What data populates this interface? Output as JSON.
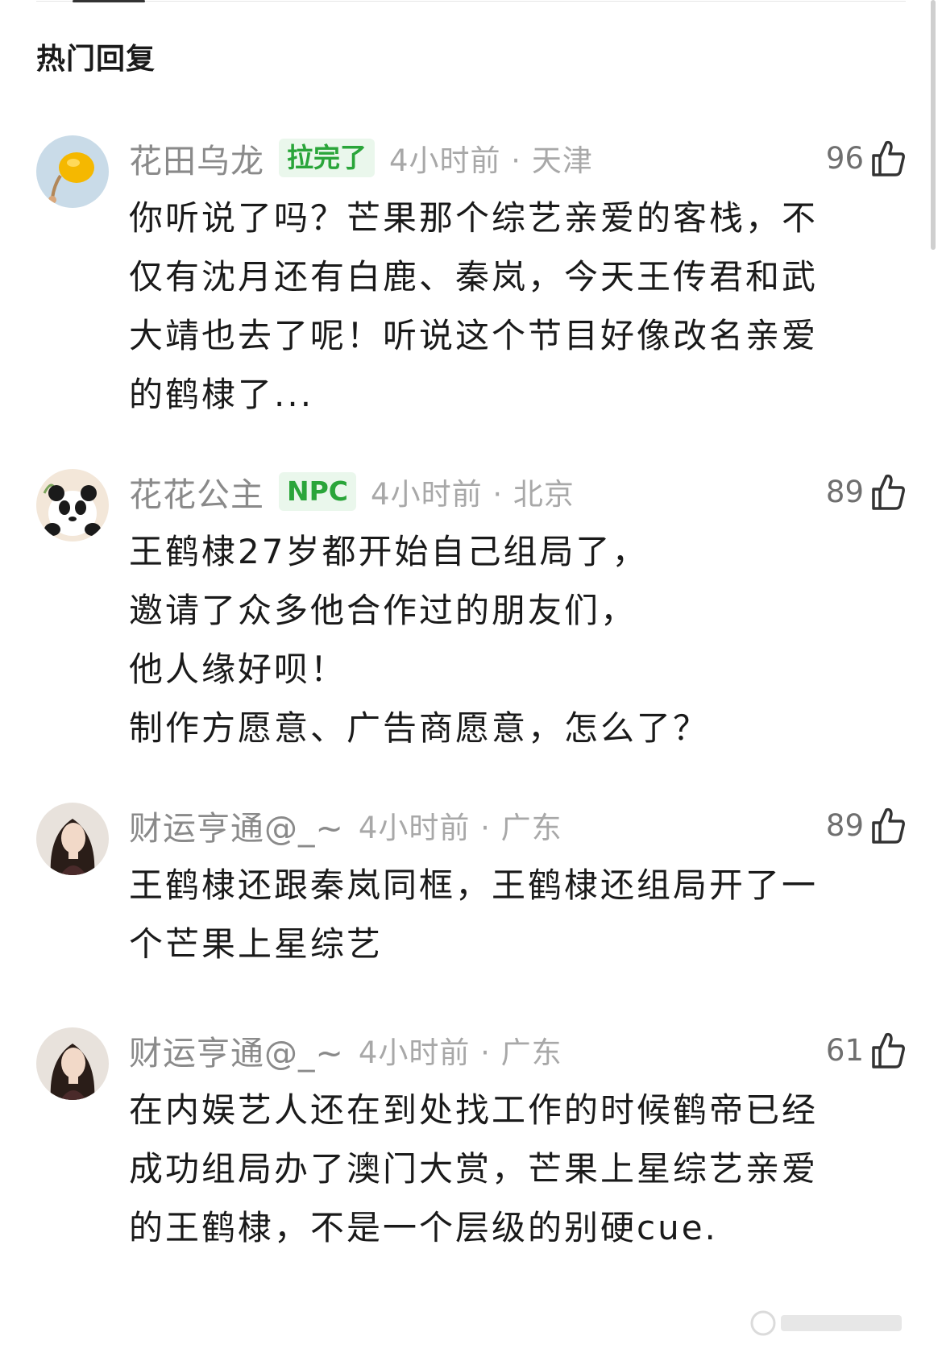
{
  "section": {
    "title": "热门回复"
  },
  "comments": [
    {
      "username": "花田乌龙",
      "badge": "拉完了",
      "time_location": "4小时前 · 天津",
      "likes": "96",
      "lines": [
        "你听说了吗？芒果那个综艺亲爱的客栈，不",
        "仅有沈月还有白鹿、秦岚，今天王传君和武",
        "大靖也去了呢！听说这个节目好像改名亲爱",
        "的鹤棣了..."
      ],
      "avatar_icon": "balloon-avatar"
    },
    {
      "username": "花花公主",
      "badge": "NPC",
      "time_location": "4小时前 · 北京",
      "likes": "89",
      "lines": [
        "王鹤棣27岁都开始自己组局了，",
        "邀请了众多他合作过的朋友们，",
        "他人缘好呗！",
        "制作方愿意、广告商愿意，怎么了？"
      ],
      "avatar_icon": "panda-avatar"
    },
    {
      "username": "财运亨通@_~",
      "badge": "",
      "time_location": "4小时前 · 广东",
      "likes": "89",
      "lines": [
        "王鹤棣还跟秦岚同框，王鹤棣还组局开了一",
        "个芒果上星综艺"
      ],
      "avatar_icon": "woman-portrait-avatar"
    },
    {
      "username": "财运亨通@_~",
      "badge": "",
      "time_location": "4小时前 · 广东",
      "likes": "61",
      "lines": [
        "在内娱艺人还在到处找工作的时候鹤帝已经",
        "成功组局办了澳门大赏，芒果上星综艺亲爱",
        "的王鹤棣，不是一个层级的别硬cue."
      ],
      "avatar_icon": "woman-portrait-avatar"
    }
  ],
  "colors": {
    "badge_bg": "#eaf7ec",
    "badge_text": "#2aa53a",
    "username": "#8a8a8a",
    "meta": "#a8a8a8",
    "body": "#1a1a1a"
  }
}
